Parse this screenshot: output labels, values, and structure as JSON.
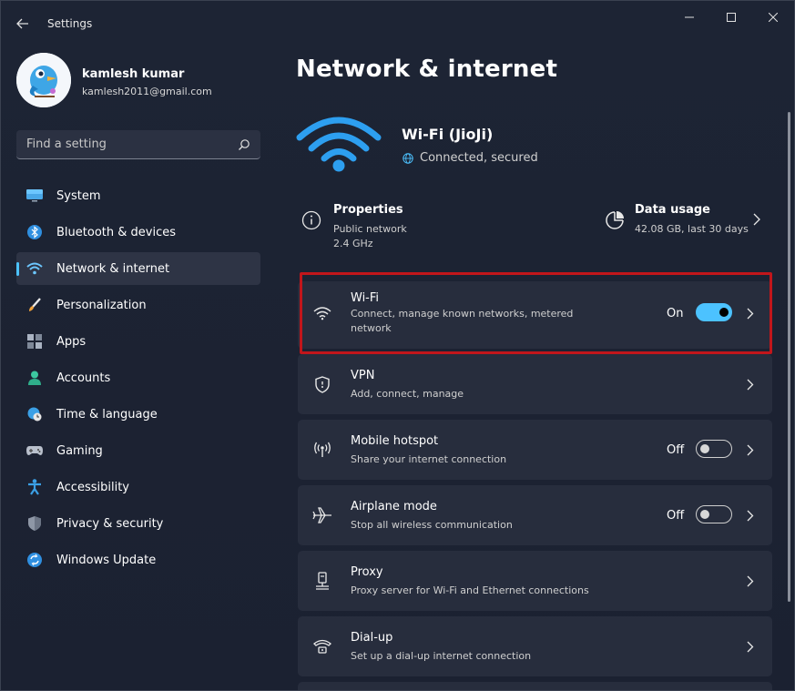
{
  "window": {
    "title": "Settings"
  },
  "profile": {
    "name": "kamlesh kumar",
    "email": "kamlesh2011@gmail.com"
  },
  "search": {
    "placeholder": "Find a setting"
  },
  "nav": {
    "items": [
      {
        "label": "System",
        "icon": "monitor-icon"
      },
      {
        "label": "Bluetooth & devices",
        "icon": "bluetooth-icon"
      },
      {
        "label": "Network & internet",
        "icon": "network-wifi-icon",
        "active": true
      },
      {
        "label": "Personalization",
        "icon": "brush-icon"
      },
      {
        "label": "Apps",
        "icon": "apps-icon"
      },
      {
        "label": "Accounts",
        "icon": "person-icon"
      },
      {
        "label": "Time & language",
        "icon": "globe-clock-icon"
      },
      {
        "label": "Gaming",
        "icon": "gamepad-icon"
      },
      {
        "label": "Accessibility",
        "icon": "accessibility-icon"
      },
      {
        "label": "Privacy & security",
        "icon": "shield-icon"
      },
      {
        "label": "Windows Update",
        "icon": "update-icon"
      }
    ]
  },
  "main": {
    "title": "Network & internet",
    "connection": {
      "name": "Wi-Fi (JioJi)",
      "status": "Connected, secured"
    },
    "properties": {
      "title": "Properties",
      "line1": "Public network",
      "line2": "2.4 GHz"
    },
    "data_usage": {
      "title": "Data usage",
      "subtitle": "42.08 GB, last 30 days"
    },
    "cards": [
      {
        "title": "Wi-Fi",
        "subtitle": "Connect, manage known networks, metered network",
        "toggle_label": "On",
        "toggle_on": true,
        "icon": "wifi-icon"
      },
      {
        "title": "VPN",
        "subtitle": "Add, connect, manage",
        "icon": "vpn-shield-icon"
      },
      {
        "title": "Mobile hotspot",
        "subtitle": "Share your internet connection",
        "toggle_label": "Off",
        "toggle_on": false,
        "icon": "hotspot-icon"
      },
      {
        "title": "Airplane mode",
        "subtitle": "Stop all wireless communication",
        "toggle_label": "Off",
        "toggle_on": false,
        "icon": "airplane-icon"
      },
      {
        "title": "Proxy",
        "subtitle": "Proxy server for Wi-Fi and Ethernet connections",
        "icon": "proxy-icon"
      },
      {
        "title": "Dial-up",
        "subtitle": "Set up a dial-up internet connection",
        "icon": "dialup-icon"
      }
    ]
  },
  "colors": {
    "accent": "#4cc2ff",
    "highlight": "#c1161b",
    "background": "#1c2233",
    "card": "#272d3d"
  }
}
